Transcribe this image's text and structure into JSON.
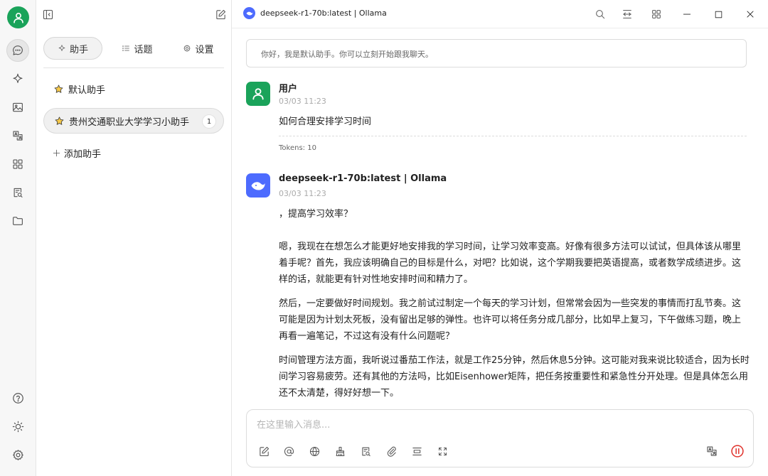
{
  "window": {
    "model_title": "deepseek-r1-70b:latest | Ollama"
  },
  "panel": {
    "tabs": [
      {
        "label": "助手",
        "icon": "sparkle-icon",
        "active": true
      },
      {
        "label": "话题",
        "icon": "list-icon",
        "active": false
      },
      {
        "label": "设置",
        "icon": "gear-icon",
        "active": false
      }
    ],
    "assistants": [
      {
        "name": "默认助手",
        "icon": "star-icon",
        "active": false
      },
      {
        "name": "贵州交通职业大学学习小助手",
        "icon": "star-icon",
        "active": true,
        "count": "1"
      }
    ],
    "add_label": "添加助手"
  },
  "chat": {
    "greeting": "你好，我是默认助手。你可以立刻开始跟我聊天。",
    "user_message": {
      "sender": "用户",
      "time": "03/03 11:23",
      "text": "如何合理安排学习时间",
      "tokens": "Tokens: 10"
    },
    "assistant_message": {
      "sender": "deepseek-r1-70b:latest | Ollama",
      "time": "03/03 11:23",
      "paragraphs": [
        "，提高学习效率？",
        "嗯，我现在在想怎么才能更好地安排我的学习时间，让学习效率变高。好像有很多方法可以试试，但具体该从哪里着手呢？首先，我应该明确自己的目标是什么，对吧？比如说，这个学期我要把英语提高，或者数学成绩进步。这样的话，就能更有针对性地安排时间和精力了。",
        "然后，一定要做好时间规划。我之前试过制定一个每天的学习计划，但常常会因为一些突发的事情而打乱节奏。这可能是因为计划太死板，没有留出足够的弹性。也许可以将任务分成几部分，比如早上复习，下午做练习题，晚上再看一遍笔记，不过这有没有什么问题呢？",
        "时间管理方法方面，我听说过番茄工作法，就是工作25分钟，然后休息5分钟。这可能对我来说比较适合，因为长时间学习容易疲劳。还有其他的方法吗，比如Eisenhower矩阵，把任务按重要性和紧急性分开处理。但是具体怎么用还不太清楚，得好好想一下。"
      ]
    }
  },
  "input": {
    "placeholder": "在这里输入消息..."
  },
  "colors": {
    "user_avatar": "#1aa35a",
    "model_avatar": "#4d6bfe",
    "stop_button": "#e0302a"
  }
}
